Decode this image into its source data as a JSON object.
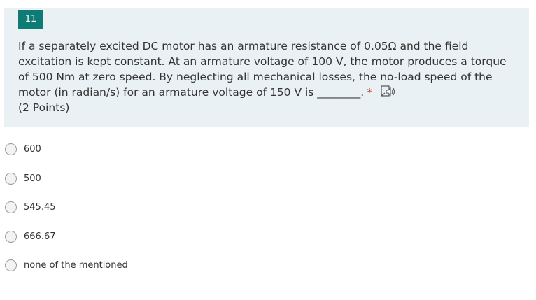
{
  "question": {
    "number": "11",
    "text": "If a separately excited DC motor has an armature resistance of 0.05Ω and the field excitation is kept constant. At an armature voltage of 100 V, the motor produces a torque of 500 Nm at zero speed. By neglecting all mechanical losses, the no-load speed of the motor (in radian/s) for an armature voltage of 150 V is ________.",
    "required_marker": "*",
    "points": "(2 Points)",
    "accent_color": "#0e7c75",
    "card_color": "#e9f1f4",
    "reader_icon": "immersive-reader-icon"
  },
  "options": [
    {
      "label": "600"
    },
    {
      "label": "500"
    },
    {
      "label": "545.45"
    },
    {
      "label": "666.67"
    },
    {
      "label": "none of the mentioned"
    }
  ]
}
